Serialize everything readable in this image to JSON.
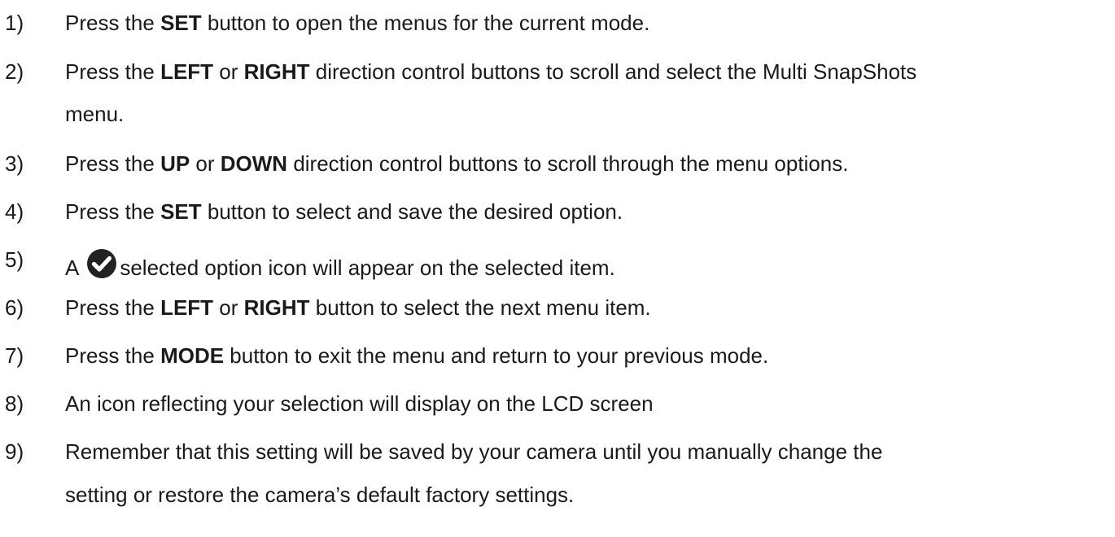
{
  "steps": [
    {
      "num": "1)",
      "parts": [
        {
          "t": "Press the ",
          "b": false
        },
        {
          "t": "SET",
          "b": true
        },
        {
          "t": " button to open the menus for the current mode.",
          "b": false
        }
      ]
    },
    {
      "num": "2)",
      "parts": [
        {
          "t": "Press the ",
          "b": false
        },
        {
          "t": "LEFT",
          "b": true
        },
        {
          "t": " or ",
          "b": false
        },
        {
          "t": "RIGHT",
          "b": true
        },
        {
          "t": " direction control buttons to scroll and select the Multi SnapShots",
          "b": false
        }
      ],
      "cont": "menu."
    },
    {
      "num": "3)",
      "parts": [
        {
          "t": "Press the ",
          "b": false
        },
        {
          "t": "UP",
          "b": true
        },
        {
          "t": " or ",
          "b": false
        },
        {
          "t": "DOWN",
          "b": true
        },
        {
          "t": " direction control buttons to scroll through the menu options.",
          "b": false
        }
      ]
    },
    {
      "num": "4)",
      "parts": [
        {
          "t": "Press the ",
          "b": false
        },
        {
          "t": "SET",
          "b": true
        },
        {
          "t": " button to select and save the desired option.",
          "b": false
        }
      ]
    },
    {
      "num": "5)",
      "pre": "A",
      "icon": "check-circle-icon",
      "post": "selected option icon will appear on the selected item."
    },
    {
      "num": "6)",
      "parts": [
        {
          "t": "Press the ",
          "b": false
        },
        {
          "t": "LEFT",
          "b": true
        },
        {
          "t": " or ",
          "b": false
        },
        {
          "t": "RIGHT",
          "b": true
        },
        {
          "t": " button to select the next menu item.",
          "b": false
        }
      ]
    },
    {
      "num": "7)",
      "parts": [
        {
          "t": "Press the ",
          "b": false
        },
        {
          "t": "MODE",
          "b": true
        },
        {
          "t": " button to exit the menu and return to your previous mode.",
          "b": false
        }
      ]
    },
    {
      "num": "8)",
      "parts": [
        {
          "t": "An icon reflecting your selection will display on the LCD screen",
          "b": false
        }
      ]
    },
    {
      "num": "9)",
      "parts": [
        {
          "t": "Remember that this setting will be saved by your camera until you manually change the",
          "b": false
        }
      ],
      "cont": "setting or restore the camera’s default factory settings."
    }
  ]
}
